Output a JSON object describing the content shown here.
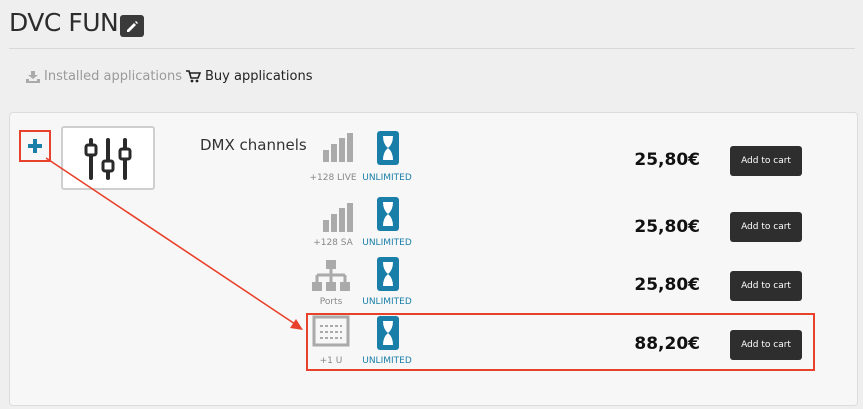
{
  "header": {
    "title": "DVC FUN",
    "edit_icon": "pencil-icon"
  },
  "tabs": [
    {
      "label": "Installed applications",
      "icon": "download-tray-icon",
      "active": false
    },
    {
      "label": "Buy applications",
      "icon": "cart-icon",
      "active": true
    }
  ],
  "app": {
    "name": "DMX channels",
    "icon": "sliders-icon",
    "expand_icon": "plus-icon"
  },
  "rows": [
    {
      "icon": "bars-icon",
      "label": "+128 LIVE",
      "duration": "UNLIMITED",
      "price": "25,80€",
      "button": "Add to cart"
    },
    {
      "icon": "bars-icon",
      "label": "+128 SA",
      "duration": "UNLIMITED",
      "price": "25,80€",
      "button": "Add to cart"
    },
    {
      "icon": "network-icon",
      "label": "Ports",
      "duration": "UNLIMITED",
      "price": "25,80€",
      "button": "Add to cart"
    },
    {
      "icon": "rack-unit-icon",
      "label": "+1 U",
      "duration": "UNLIMITED",
      "price": "88,20€",
      "button": "Add to cart"
    }
  ],
  "colors": {
    "annotation": "#e8422c",
    "accent": "#1a7fa8",
    "button": "#2e2e2e"
  }
}
